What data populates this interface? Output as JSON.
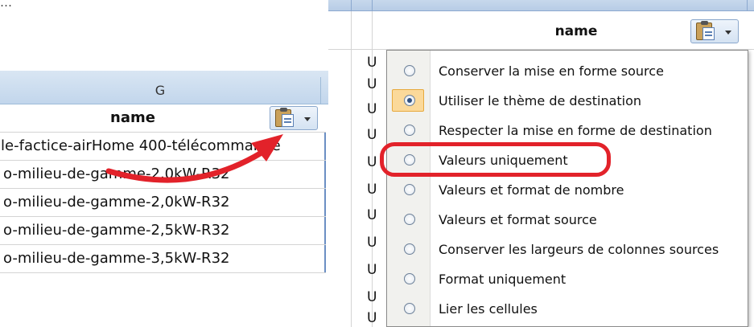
{
  "left_sheet": {
    "column_letter": "G",
    "header": "name",
    "rows": [
      "ale-factice-airHome 400-télécommande",
      "o-milieu-de-gamme-2,0kW-R32",
      "o-milieu-de-gamme-2,0kW-R32",
      "o-milieu-de-gamme-2,5kW-R32",
      "o-milieu-de-gamme-3,5kW-R32"
    ]
  },
  "right_sheet": {
    "header": "name",
    "left_fragments": [
      "U",
      "U",
      "U",
      "U",
      "U",
      "U",
      "U",
      "U",
      "U",
      "U",
      "U"
    ]
  },
  "paste_menu": {
    "items": [
      {
        "label": "Conserver la mise en forme source",
        "checked": false
      },
      {
        "label": "Utiliser le thème de destination",
        "checked": true
      },
      {
        "label": "Respecter la mise en forme de destination",
        "checked": false
      },
      {
        "label": "Valeurs uniquement",
        "checked": false
      },
      {
        "label": "Valeurs et format de nombre",
        "checked": false
      },
      {
        "label": "Valeurs et format source",
        "checked": false
      },
      {
        "label": "Conserver les largeurs de colonnes sources",
        "checked": false
      },
      {
        "label": "Format uniquement",
        "checked": false
      },
      {
        "label": "Lier les cellules",
        "checked": false
      }
    ],
    "highlighted_item": "Valeurs uniquement"
  },
  "colors": {
    "highlight": "#e2222a",
    "header_bg": "#c2d6ec",
    "selection": "#fbd99a"
  },
  "icons": {
    "paste_options": "clipboard-paste-icon",
    "dropdown": "caret-down-icon",
    "arrow": "red-curved-arrow"
  }
}
